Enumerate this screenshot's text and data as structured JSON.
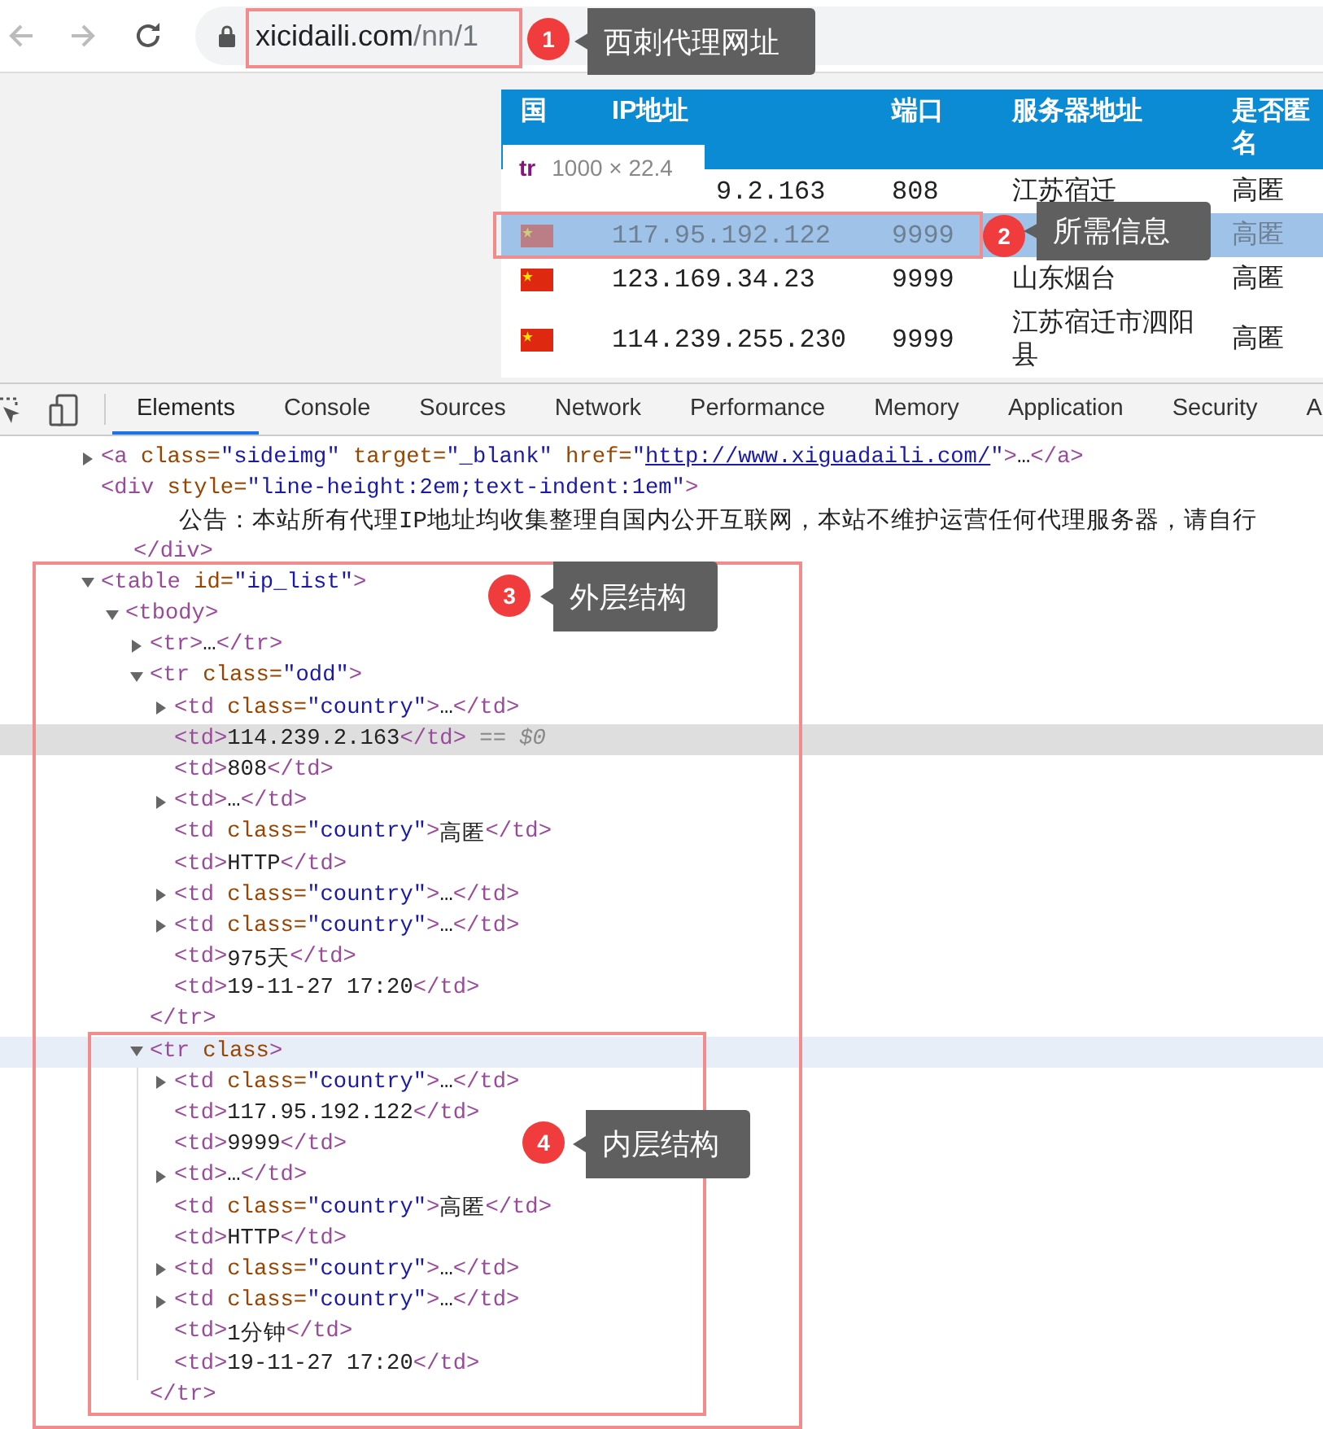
{
  "browser": {
    "url_host": "xicidaili.com",
    "url_path": "/nn/1"
  },
  "page": {
    "columns": [
      "国",
      "IP地址",
      "端口",
      "服务器地址",
      "是否匿名"
    ],
    "rows": [
      {
        "flag": false,
        "ip": "9.2.163",
        "port": "808",
        "location": "江苏宿迁",
        "anonymity": "高匿",
        "selected": false
      },
      {
        "flag": true,
        "ip": "117.95.192.122",
        "port": "9999",
        "anonymity": "高匿",
        "selected": true
      },
      {
        "flag": true,
        "ip": "123.169.34.23",
        "port": "9999",
        "location": "山东烟台",
        "anonymity": "高匿",
        "selected": false
      },
      {
        "flag": true,
        "ip": "114.239.255.230",
        "port": "9999",
        "location": "江苏宿迁市泗阳县",
        "anonymity": "高匿",
        "selected": false
      }
    ],
    "tooltip": {
      "tag": "tr",
      "size": "1000 × 22.4"
    }
  },
  "devtools": {
    "tabs": [
      {
        "label": "Elements",
        "selected": true
      },
      {
        "label": "Console",
        "selected": false
      },
      {
        "label": "Sources",
        "selected": false
      },
      {
        "label": "Network",
        "selected": false
      },
      {
        "label": "Performance",
        "selected": false
      },
      {
        "label": "Memory",
        "selected": false
      },
      {
        "label": "Application",
        "selected": false
      },
      {
        "label": "Security",
        "selected": false
      },
      {
        "label": "A",
        "selected": false
      }
    ],
    "tree": [
      {
        "line": [
          {
            "tag": "<a"
          },
          {
            "attr": " class="
          },
          {
            "value": "\"sideimg\""
          },
          {
            "attr": " target="
          },
          {
            "value": "\"_blank\""
          },
          {
            "attr": " href="
          },
          {
            "value": "\""
          },
          {
            "link": "http://www.xiguadaili.com/"
          },
          {
            "value": "\""
          },
          {
            "tag": ">"
          },
          {
            "text": "…"
          },
          {
            "tag": "</a>"
          }
        ],
        "expanded": false,
        "selected": false,
        "hovered": false
      },
      {
        "line": [
          {
            "tag": "<div"
          },
          {
            "attr": " style="
          },
          {
            "value": "\"line-height:2em;text-indent:1em\""
          },
          {
            "tag": ">"
          }
        ],
        "text": "公告：本站所有代理IP地址均收集整理自国内公开互联网，本站不维护运营任何代理服务器，请自行",
        "close": [
          {
            "tag": "</div>"
          }
        ],
        "selected": false,
        "hovered": false
      },
      {
        "line": [
          {
            "tag": "<table"
          },
          {
            "attr": " id="
          },
          {
            "value": "\"ip_list\""
          },
          {
            "tag": ">"
          }
        ],
        "expanded": true,
        "selected": false,
        "hovered": false,
        "children": [
          {
            "line": [
              {
                "tag": "<tbody>"
              }
            ],
            "expanded": true,
            "selected": false,
            "hovered": false,
            "children": [
              {
                "line": [
                  {
                    "tag": "<tr>"
                  },
                  {
                    "text": "…"
                  },
                  {
                    "tag": "</tr>"
                  }
                ],
                "expanded": false,
                "selected": false,
                "hovered": false
              },
              {
                "line": [
                  {
                    "tag": "<tr"
                  },
                  {
                    "attr": " class="
                  },
                  {
                    "value": "\"odd\""
                  },
                  {
                    "tag": ">"
                  }
                ],
                "expanded": true,
                "selected": false,
                "hovered": false,
                "children": [
                  {
                    "line": [
                      {
                        "tag": "<td"
                      },
                      {
                        "attr": " class="
                      },
                      {
                        "value": "\"country\""
                      },
                      {
                        "tag": ">"
                      },
                      {
                        "text": "…"
                      },
                      {
                        "tag": "</td>"
                      }
                    ],
                    "expanded": false,
                    "selected": false,
                    "hovered": false
                  },
                  {
                    "line": [
                      {
                        "tag": "<td>"
                      },
                      {
                        "text": "114.239.2.163"
                      },
                      {
                        "tag": "</td>"
                      },
                      {
                        "hint": " == $0"
                      }
                    ],
                    "selected": true,
                    "hovered": false
                  },
                  {
                    "line": [
                      {
                        "tag": "<td>"
                      },
                      {
                        "text": "808"
                      },
                      {
                        "tag": "</td>"
                      }
                    ],
                    "selected": false,
                    "hovered": false
                  },
                  {
                    "line": [
                      {
                        "tag": "<td>"
                      },
                      {
                        "text": "…"
                      },
                      {
                        "tag": "</td>"
                      }
                    ],
                    "expanded": false,
                    "selected": false,
                    "hovered": false
                  },
                  {
                    "line": [
                      {
                        "tag": "<td"
                      },
                      {
                        "attr": " class="
                      },
                      {
                        "value": "\"country\""
                      },
                      {
                        "tag": ">"
                      },
                      {
                        "text": "高匿"
                      },
                      {
                        "tag": "</td>"
                      }
                    ],
                    "selected": false,
                    "hovered": false
                  },
                  {
                    "line": [
                      {
                        "tag": "<td>"
                      },
                      {
                        "text": "HTTP"
                      },
                      {
                        "tag": "</td>"
                      }
                    ],
                    "selected": false,
                    "hovered": false
                  },
                  {
                    "line": [
                      {
                        "tag": "<td"
                      },
                      {
                        "attr": " class="
                      },
                      {
                        "value": "\"country\""
                      },
                      {
                        "tag": ">"
                      },
                      {
                        "text": "…"
                      },
                      {
                        "tag": "</td>"
                      }
                    ],
                    "expanded": false,
                    "selected": false,
                    "hovered": false
                  },
                  {
                    "line": [
                      {
                        "tag": "<td"
                      },
                      {
                        "attr": " class="
                      },
                      {
                        "value": "\"country\""
                      },
                      {
                        "tag": ">"
                      },
                      {
                        "text": "…"
                      },
                      {
                        "tag": "</td>"
                      }
                    ],
                    "expanded": false,
                    "selected": false,
                    "hovered": false
                  },
                  {
                    "line": [
                      {
                        "tag": "<td>"
                      },
                      {
                        "text": "975天"
                      },
                      {
                        "tag": "</td>"
                      }
                    ],
                    "selected": false,
                    "hovered": false
                  },
                  {
                    "line": [
                      {
                        "tag": "<td>"
                      },
                      {
                        "text": "19-11-27 17:20"
                      },
                      {
                        "tag": "</td>"
                      }
                    ],
                    "selected": false,
                    "hovered": false
                  }
                ],
                "close": [
                  {
                    "tag": "</tr>"
                  }
                ]
              },
              {
                "line": [
                  {
                    "tag": "<tr"
                  },
                  {
                    "attr": " class"
                  },
                  {
                    "tag": ">"
                  }
                ],
                "expanded": true,
                "selected": false,
                "hovered": true,
                "children": [
                  {
                    "line": [
                      {
                        "tag": "<td"
                      },
                      {
                        "attr": " class="
                      },
                      {
                        "value": "\"country\""
                      },
                      {
                        "tag": ">"
                      },
                      {
                        "text": "…"
                      },
                      {
                        "tag": "</td>"
                      }
                    ],
                    "expanded": false,
                    "selected": false,
                    "hovered": false
                  },
                  {
                    "line": [
                      {
                        "tag": "<td>"
                      },
                      {
                        "text": "117.95.192.122"
                      },
                      {
                        "tag": "</td>"
                      }
                    ],
                    "selected": false,
                    "hovered": false
                  },
                  {
                    "line": [
                      {
                        "tag": "<td>"
                      },
                      {
                        "text": "9999"
                      },
                      {
                        "tag": "</td>"
                      }
                    ],
                    "selected": false,
                    "hovered": false
                  },
                  {
                    "line": [
                      {
                        "tag": "<td>"
                      },
                      {
                        "text": "…"
                      },
                      {
                        "tag": "</td>"
                      }
                    ],
                    "expanded": false,
                    "selected": false,
                    "hovered": false
                  },
                  {
                    "line": [
                      {
                        "tag": "<td"
                      },
                      {
                        "attr": " class="
                      },
                      {
                        "value": "\"country\""
                      },
                      {
                        "tag": ">"
                      },
                      {
                        "text": "高匿"
                      },
                      {
                        "tag": "</td>"
                      }
                    ],
                    "selected": false,
                    "hovered": false
                  },
                  {
                    "line": [
                      {
                        "tag": "<td>"
                      },
                      {
                        "text": "HTTP"
                      },
                      {
                        "tag": "</td>"
                      }
                    ],
                    "selected": false,
                    "hovered": false
                  },
                  {
                    "line": [
                      {
                        "tag": "<td"
                      },
                      {
                        "attr": " class="
                      },
                      {
                        "value": "\"country\""
                      },
                      {
                        "tag": ">"
                      },
                      {
                        "text": "…"
                      },
                      {
                        "tag": "</td>"
                      }
                    ],
                    "expanded": false,
                    "selected": false,
                    "hovered": false
                  },
                  {
                    "line": [
                      {
                        "tag": "<td"
                      },
                      {
                        "attr": " class="
                      },
                      {
                        "value": "\"country\""
                      },
                      {
                        "tag": ">"
                      },
                      {
                        "text": "…"
                      },
                      {
                        "tag": "</td>"
                      }
                    ],
                    "expanded": false,
                    "selected": false,
                    "hovered": false
                  },
                  {
                    "line": [
                      {
                        "tag": "<td>"
                      },
                      {
                        "text": "1分钟"
                      },
                      {
                        "tag": "</td>"
                      }
                    ],
                    "selected": false,
                    "hovered": false
                  },
                  {
                    "line": [
                      {
                        "tag": "<td>"
                      },
                      {
                        "text": "19-11-27 17:20"
                      },
                      {
                        "tag": "</td>"
                      }
                    ],
                    "selected": false,
                    "hovered": false
                  }
                ],
                "close": [
                  {
                    "tag": "</tr>"
                  }
                ]
              }
            ]
          }
        ]
      }
    ]
  },
  "annotations": [
    {
      "number": "1",
      "label": "西刺代理网址"
    },
    {
      "number": "2",
      "label": "所需信息"
    },
    {
      "number": "3",
      "label": "外层结构"
    },
    {
      "number": "4",
      "label": "内层结构"
    }
  ]
}
